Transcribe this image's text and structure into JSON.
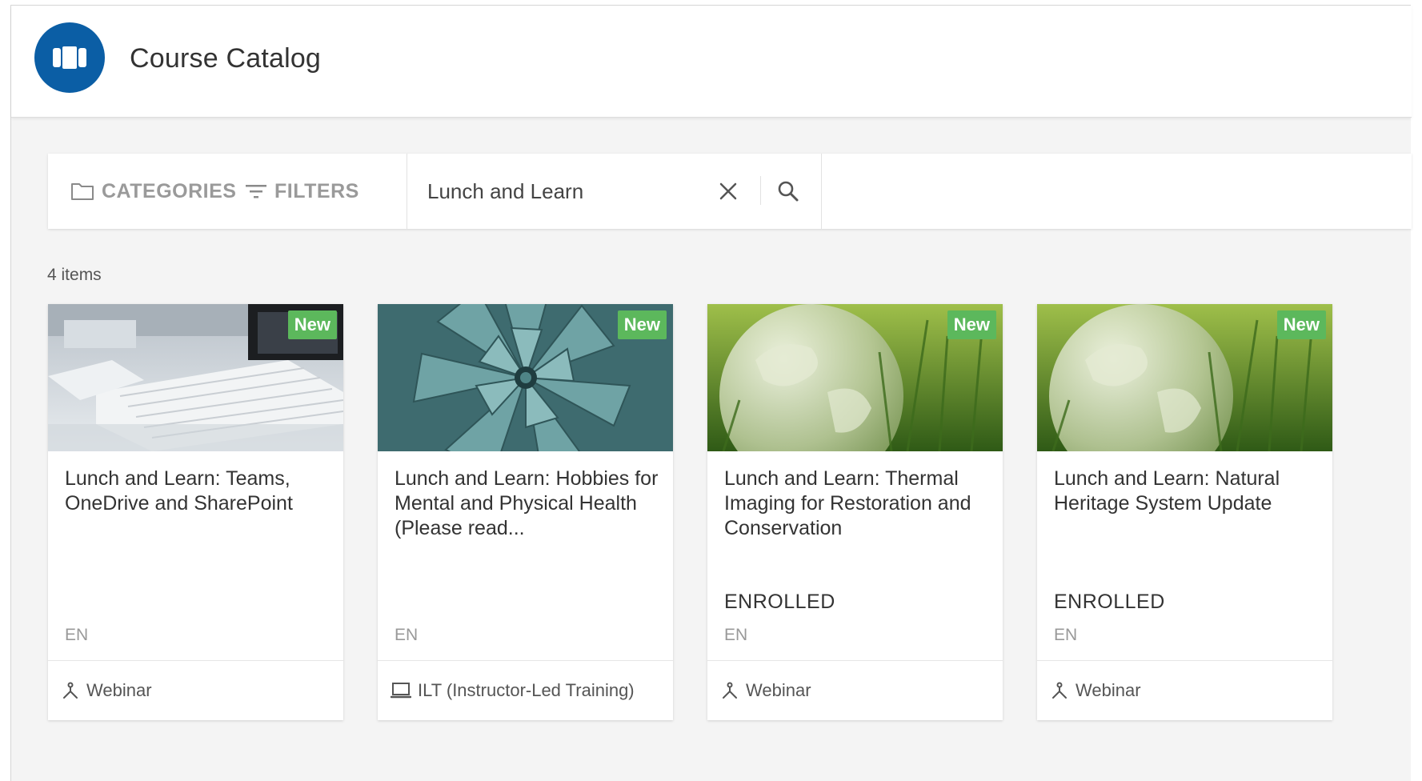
{
  "header": {
    "title": "Course Catalog"
  },
  "toolbar": {
    "categories_label": "CATEGORIES",
    "filters_label": "FILTERS",
    "search_value": "Lunch and Learn"
  },
  "results": {
    "count_label": "4 items"
  },
  "cards": [
    {
      "badge": "New",
      "title": "Lunch and Learn: Teams, OneDrive and SharePoint",
      "status": "",
      "language": "EN",
      "type_icon": "webinar-icon",
      "type": "Webinar",
      "thumbnail": "keyboard-photo"
    },
    {
      "badge": "New",
      "title": "Lunch and Learn: Hobbies for Mental and Physical Health (Please read...",
      "status": "",
      "language": "EN",
      "type_icon": "classroom-icon",
      "type": "ILT (Instructor-Led Training)",
      "thumbnail": "succulent-photo"
    },
    {
      "badge": "New",
      "title": "Lunch and Learn: Thermal Imaging for Restoration and Conservation",
      "status": "ENROLLED",
      "language": "EN",
      "type_icon": "webinar-icon",
      "type": "Webinar",
      "thumbnail": "glass-globe-photo"
    },
    {
      "badge": "New",
      "title": "Lunch and Learn: Natural Heritage System Update",
      "status": "ENROLLED",
      "language": "EN",
      "type_icon": "webinar-icon",
      "type": "Webinar",
      "thumbnail": "glass-globe-photo"
    }
  ],
  "colors": {
    "brand": "#0b5ea5",
    "badge": "#5cb85c",
    "background": "#f4f4f4"
  }
}
